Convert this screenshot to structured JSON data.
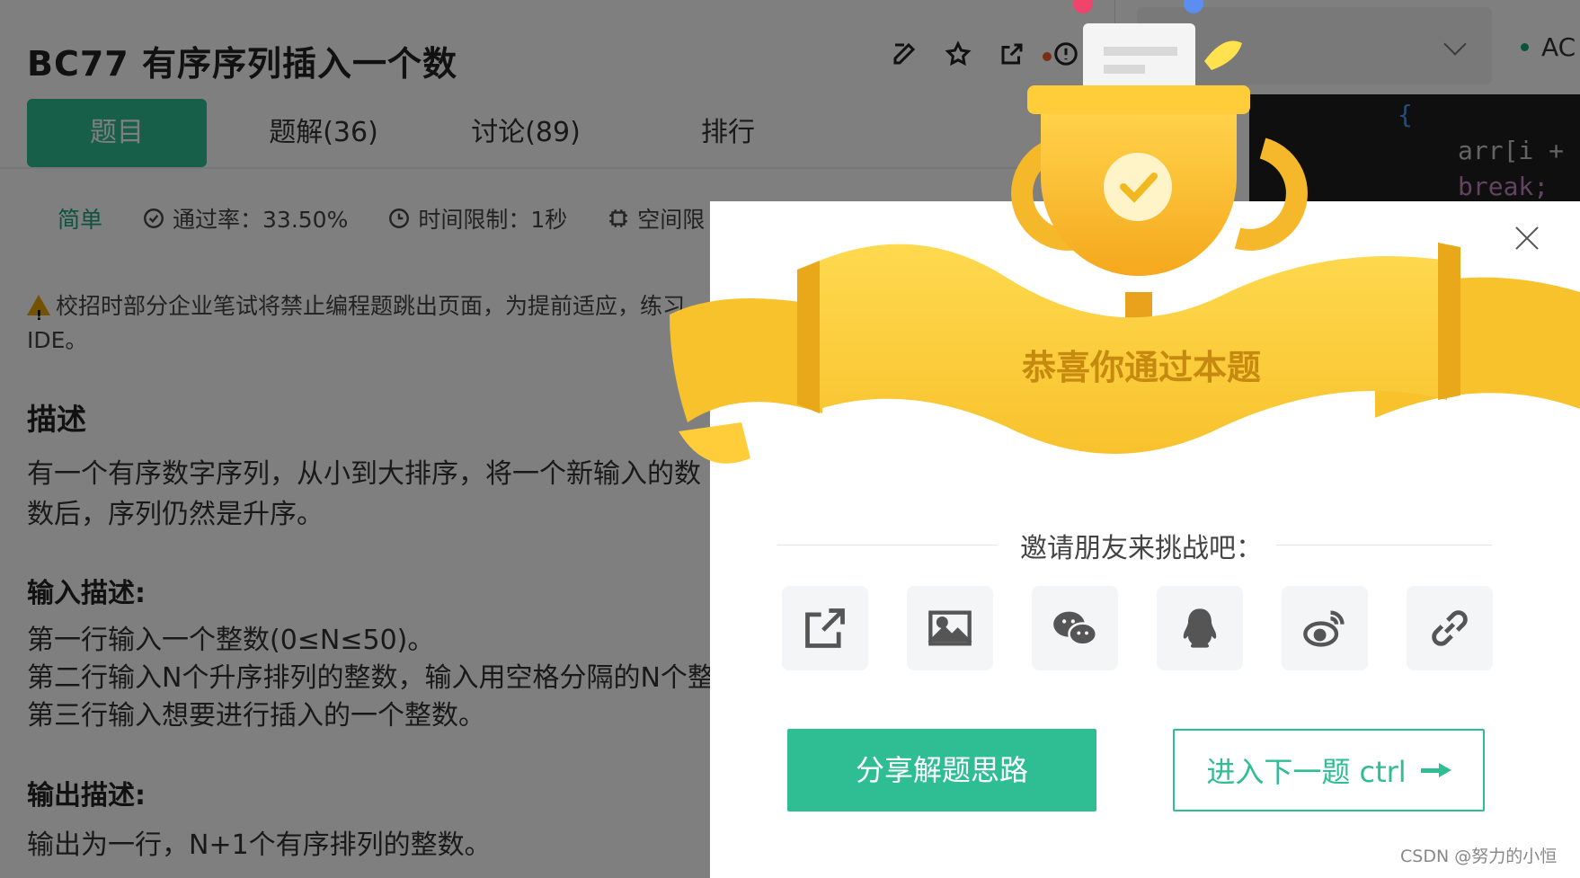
{
  "problem": {
    "title": "BC77  有序序列插入一个数",
    "tabs": [
      "题目",
      "题解(36)",
      "讨论(89)",
      "排行"
    ],
    "difficulty": "简单",
    "pass_rate": "通过率：33.50%",
    "time_limit": "时间限制：1秒",
    "space_limit": "空间限",
    "warning_line1": "校招时部分企业笔试将禁止编程题跳出页面，为提前适应，练习",
    "warning_line2": "IDE。",
    "desc_heading": "描述",
    "desc_line1": "有一个有序数字序列，从小到大排序，将一个新输入的数",
    "desc_line2": "数后，序列仍然是升序。",
    "input_heading": "输入描述:",
    "input_line1": "第一行输入一个整数(0≤N≤50)。",
    "input_line2": "第二行输入N个升序排列的整数，输入用空格分隔的N个整数",
    "input_line3": "第三行输入想要进行插入的一个整数。",
    "output_heading": "输出描述:",
    "output_line1": "输出为一行，N+1个有序排列的整数。"
  },
  "editor": {
    "status": "AC",
    "code_lines": [
      "{",
      "arr[i +",
      "break;"
    ]
  },
  "modal": {
    "congrats": "恭喜你通过本题",
    "invite": "邀请朋友来挑战吧：",
    "share_button": "分享解题思路",
    "next_button": "进入下一题 ctrl",
    "share_icons": [
      "share-external-icon",
      "image-icon",
      "wechat-icon",
      "qq-icon",
      "weibo-icon",
      "link-icon"
    ]
  },
  "watermark": "CSDN @努力的小恒",
  "colors": {
    "accent": "#2fbe93",
    "gold": "#f5b82a",
    "gold_text": "#c78a10"
  }
}
